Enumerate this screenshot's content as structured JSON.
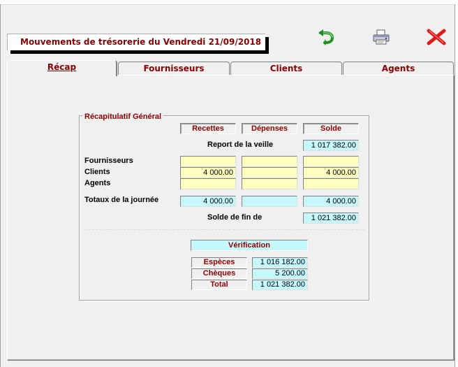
{
  "window": {
    "title": "Mouvements de trésorerie du  Vendredi 21/09/2018"
  },
  "toolbar": {
    "refresh_icon": "green-undo-arrow-icon",
    "print_icon": "printer-icon",
    "close_icon": "red-x-close-icon"
  },
  "tabs": [
    {
      "label": "Récap",
      "active": true
    },
    {
      "label": "Fournisseurs",
      "active": false
    },
    {
      "label": "Clients",
      "active": false
    },
    {
      "label": "Agents",
      "active": false
    }
  ],
  "recap": {
    "group_title": "Récapitulatif Général",
    "columns": {
      "recettes": "Recettes",
      "depenses": "Dépenses",
      "solde": "Solde"
    },
    "report_label": "Report de la veille",
    "report_value": "1 017 382.00",
    "rows": [
      {
        "label": "Fournisseurs",
        "recettes": "",
        "depenses": "",
        "solde": ""
      },
      {
        "label": "Clients",
        "recettes": "4 000.00",
        "depenses": "",
        "solde": "4 000.00"
      },
      {
        "label": "Agents",
        "recettes": "",
        "depenses": "",
        "solde": ""
      }
    ],
    "totals_label": "Totaux de la journée",
    "totals": {
      "recettes": "4 000.00",
      "depenses": "",
      "solde": "4 000.00"
    },
    "end_label": "Solde de fin de",
    "end_value": "1 021 382.00"
  },
  "verification": {
    "title": "Vérification",
    "items": [
      {
        "label": "Espèces",
        "value": "1 016 182.00"
      },
      {
        "label": "Chèques",
        "value": "5 200.00"
      },
      {
        "label": "Total",
        "value": "1 021 382.00"
      }
    ]
  },
  "colors": {
    "label_red": "#8b0000",
    "yellow_field": "#ffffc0",
    "cyan_field": "#c4f8fc"
  }
}
